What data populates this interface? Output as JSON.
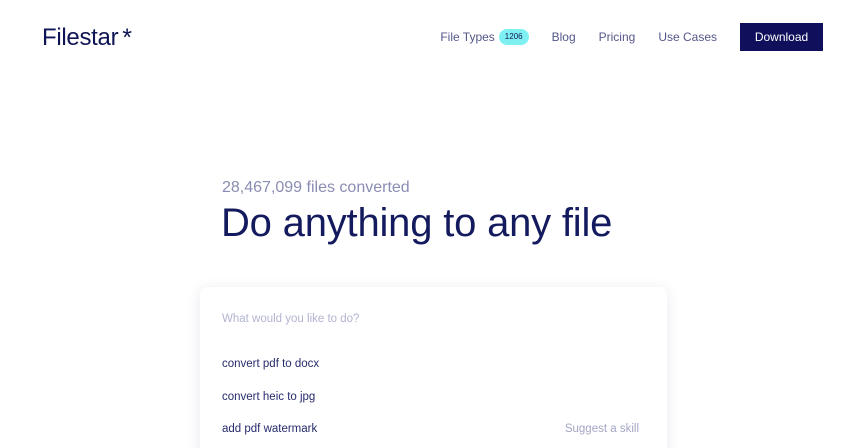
{
  "header": {
    "logo_text": "Filestar",
    "logo_mark": "*",
    "nav": {
      "file_types_label": "File Types",
      "file_types_count": "1206",
      "blog_label": "Blog",
      "pricing_label": "Pricing",
      "use_cases_label": "Use Cases"
    },
    "download_label": "Download"
  },
  "hero": {
    "counter": "28,467,099 files converted",
    "headline": "Do anything to any file"
  },
  "search": {
    "placeholder": "What would you like to do?",
    "value": "",
    "suggestions": [
      "convert pdf to docx",
      "convert heic to jpg",
      "add pdf watermark"
    ],
    "suggest_skill_label": "Suggest a skill"
  },
  "colors": {
    "brand_navy": "#0f0f5c",
    "badge_cyan": "#7ff0f2",
    "muted_text": "#8a8db3"
  }
}
